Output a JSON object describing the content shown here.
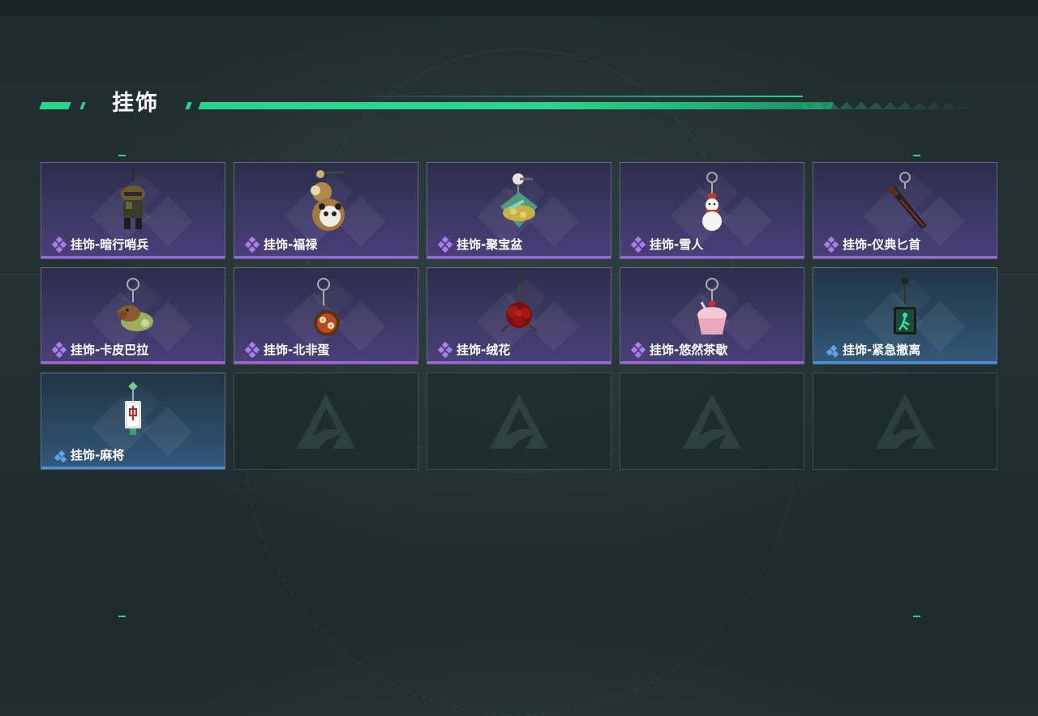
{
  "header": {
    "title": "挂饰"
  },
  "colors": {
    "accent": "#2ad48c",
    "rare_purple": "#9b66d6",
    "rare_blue": "#4a90d8"
  },
  "items": [
    {
      "label": "挂饰-暗行哨兵",
      "rarity": "purple",
      "icon": "soldier-charm-icon"
    },
    {
      "label": "挂饰-福禄",
      "rarity": "purple",
      "icon": "gourd-panda-charm-icon"
    },
    {
      "label": "挂饰-聚宝盆",
      "rarity": "purple",
      "icon": "treasure-bowl-charm-icon"
    },
    {
      "label": "挂饰-雪人",
      "rarity": "purple",
      "icon": "snowman-charm-icon"
    },
    {
      "label": "挂饰-仪典匕首",
      "rarity": "purple",
      "icon": "dagger-charm-icon"
    },
    {
      "label": "挂饰-卡皮巴拉",
      "rarity": "purple",
      "icon": "capybara-charm-icon"
    },
    {
      "label": "挂饰-北非蛋",
      "rarity": "purple",
      "icon": "shakshuka-charm-icon"
    },
    {
      "label": "挂饰-绒花",
      "rarity": "purple",
      "icon": "velvet-flower-charm-icon"
    },
    {
      "label": "挂饰-悠然茶歇",
      "rarity": "purple",
      "icon": "cupcake-charm-icon"
    },
    {
      "label": "挂饰-紧急撤离",
      "rarity": "blue",
      "icon": "exit-sign-charm-icon"
    },
    {
      "label": "挂饰-麻将",
      "rarity": "blue",
      "icon": "mahjong-charm-icon"
    }
  ],
  "empty_slots": 4
}
